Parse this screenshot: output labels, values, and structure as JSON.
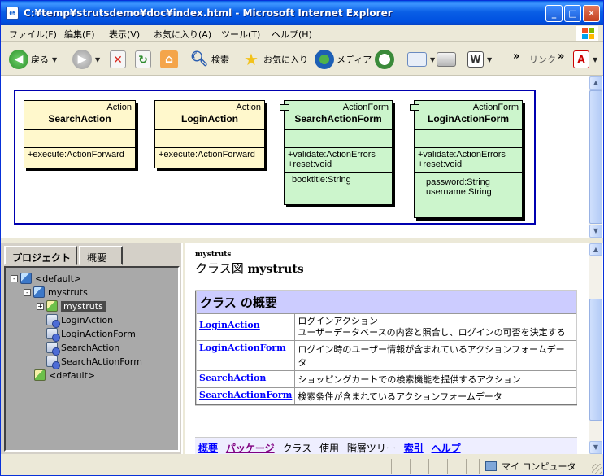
{
  "window": {
    "title": "C:¥temp¥strutsdemo¥doc¥index.html - Microsoft Internet Explorer",
    "app_icon": "e",
    "minimize": "_",
    "maximize": "□",
    "close": "✕"
  },
  "menu": [
    "ファイル(F)",
    "編集(E)",
    "表示(V)",
    "お気に入り(A)",
    "ツール(T)",
    "ヘルプ(H)"
  ],
  "toolbar": {
    "back": "戻る",
    "search": "検索",
    "favorites": "お気に入り",
    "media": "メディア",
    "links": "リンク",
    "more": "»"
  },
  "diagram": {
    "classes": [
      {
        "stereotype": "Action",
        "name": "SearchAction",
        "attributes": [],
        "operations": [
          "+execute:ActionForward"
        ],
        "extra": []
      },
      {
        "stereotype": "Action",
        "name": "LoginAction",
        "attributes": [],
        "operations": [
          "+execute:ActionForward"
        ],
        "extra": []
      },
      {
        "stereotype": "ActionForm",
        "name": "SearchActionForm",
        "attributes": [],
        "operations": [
          "+validate:ActionErrors",
          "+reset:void"
        ],
        "extra": [
          "booktitle:String"
        ]
      },
      {
        "stereotype": "ActionForm",
        "name": "LoginActionForm",
        "attributes": [],
        "operations": [
          "+validate:ActionErrors",
          "+reset:void"
        ],
        "extra": [
          "password:String",
          "username:String"
        ]
      }
    ]
  },
  "left": {
    "tabs": [
      "プロジェクト",
      "概要"
    ],
    "tree": [
      {
        "label": "<default>",
        "toggle": "-",
        "icon": "project"
      },
      {
        "label": "mystruts",
        "toggle": "-",
        "icon": "project"
      },
      {
        "label": "mystruts",
        "toggle": "+",
        "icon": "package"
      },
      {
        "label": "LoginAction",
        "toggle": "",
        "icon": "class"
      },
      {
        "label": "LoginActionForm",
        "toggle": "",
        "icon": "class"
      },
      {
        "label": "SearchAction",
        "toggle": "",
        "icon": "class"
      },
      {
        "label": "SearchActionForm",
        "toggle": "",
        "icon": "class"
      },
      {
        "label": "<default>",
        "toggle": "",
        "icon": "package"
      }
    ]
  },
  "content": {
    "package_small": "mystruts",
    "title_prefix": "クラス図",
    "title_name": "mystruts",
    "summary_header": "クラス の概要",
    "rows": [
      {
        "name": "LoginAction",
        "desc": "ログインアクション\nユーザーデータベースの内容と照合し、ログインの可否を決定する"
      },
      {
        "name": "LoginActionForm",
        "desc": "ログイン時のユーザー情報が含まれているアクションフォームデータ"
      },
      {
        "name": "SearchAction",
        "desc": "ショッピングカートでの検索機能を提供するアクション"
      },
      {
        "name": "SearchActionForm",
        "desc": "検索条件が含まれているアクションフォームデータ"
      }
    ],
    "nav": {
      "overview": "概要",
      "package": "パッケージ",
      "class": "クラス",
      "use": "使用",
      "tree": "階層ツリー",
      "index": "索引",
      "help": "ヘルプ"
    }
  },
  "status": {
    "zone": "マイ コンピュータ"
  }
}
